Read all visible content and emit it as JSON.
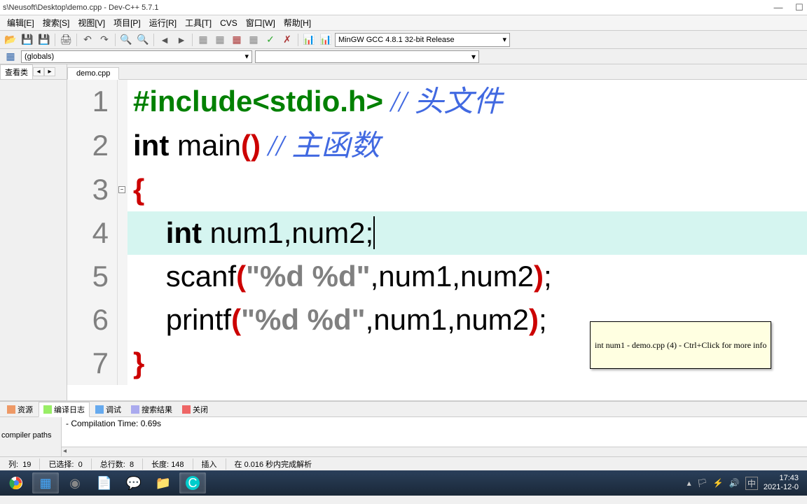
{
  "window": {
    "title": "s\\Neusoft\\Desktop\\demo.cpp - Dev-C++ 5.7.1"
  },
  "menu": [
    "编辑[E]",
    "搜索[S]",
    "视图[V]",
    "项目[P]",
    "运行[R]",
    "工具[T]",
    "CVS",
    "窗口[W]",
    "帮助[H]"
  ],
  "compiler": "MinGW GCC 4.8.1 32-bit Release",
  "globals": "(globals)",
  "left_tab": "查看类",
  "file_tab": "demo.cpp",
  "code": {
    "l1_pp": "#include<stdio.h>",
    "l1_cmt": " // 头文件",
    "l2_kw": "int",
    "l2_fn": " main",
    "l2_p": "()",
    "l2_cmt": " // 主函数",
    "l3": "{",
    "l4_kw": "int",
    "l4_rest": " num1,num2;",
    "l5_fn": "scanf",
    "l5_p1": "(",
    "l5_str": "\"%d %d\"",
    "l5_args": ",num1,num2",
    "l5_p2": ")",
    "l5_semi": ";",
    "l6_fn": "printf",
    "l6_p1": "(",
    "l6_str": "\"%d %d\"",
    "l6_args": ",num1,num2",
    "l6_p2": ")",
    "l6_semi": ";",
    "l7": "}"
  },
  "tooltip": "int num1 - demo.cpp (4) - Ctrl+Click for more info",
  "bottom_tabs": [
    "资源",
    "编译日志",
    "调试",
    "搜索结果",
    "关闭"
  ],
  "bottom_left": "compiler paths",
  "compile_msg": "- Compilation Time: 0.69s",
  "status": {
    "col_label": "列:",
    "col_val": "19",
    "sel_label": "已选择:",
    "sel_val": "0",
    "lines_label": "总行数:",
    "lines_val": "8",
    "len_label": "长度:",
    "len_val": "148",
    "mode": "插入",
    "parse": "在 0.016 秒内完成解析"
  },
  "tray": {
    "time": "17:43",
    "date": "2021-12-0",
    "ime": "中"
  }
}
